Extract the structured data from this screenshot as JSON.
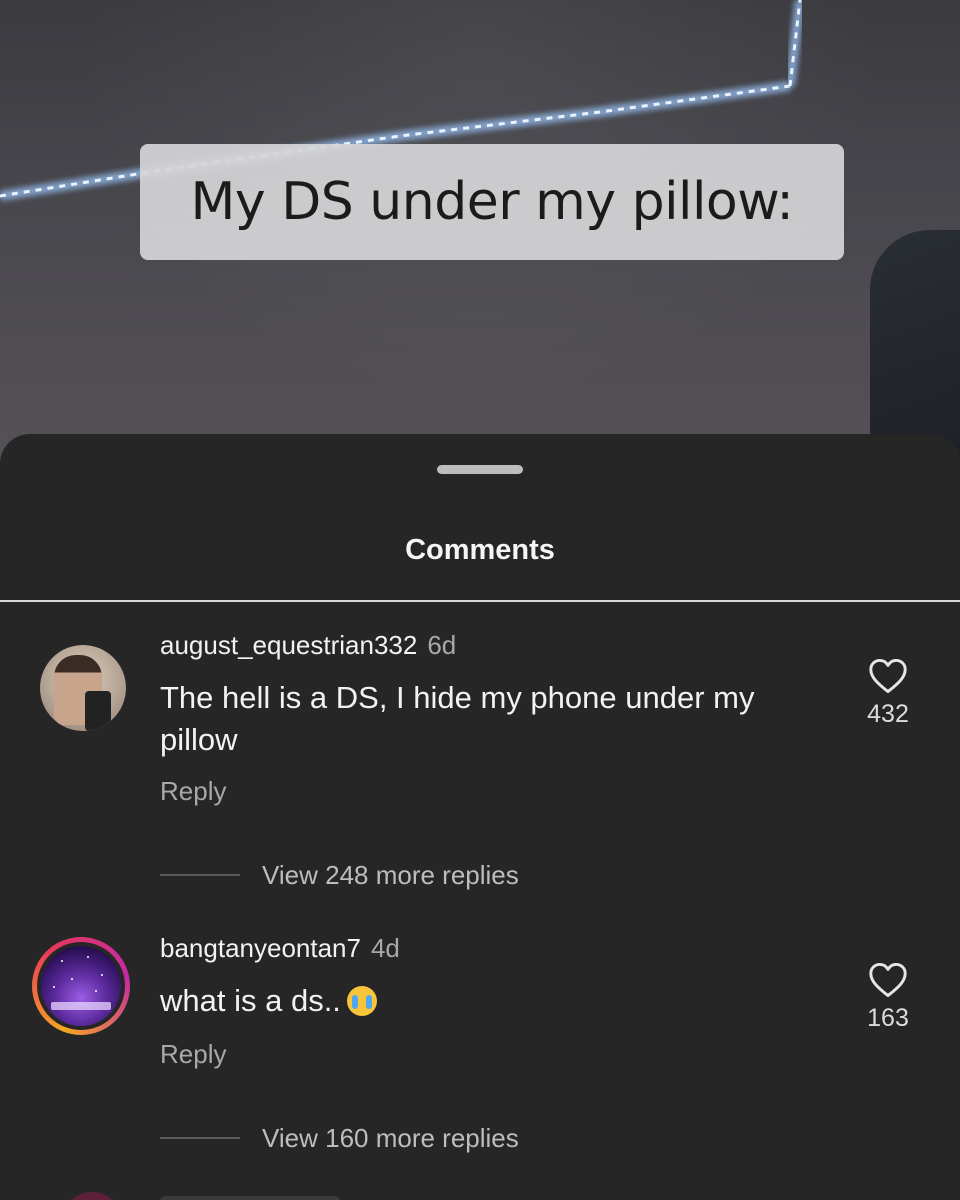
{
  "video": {
    "caption": "My DS under my pillow:"
  },
  "sheet": {
    "title": "Comments"
  },
  "comments": [
    {
      "username": "august_equestrian332",
      "time": "6d",
      "text": "The hell is a DS, I hide my phone under my pillow",
      "reply_label": "Reply",
      "likes": "432",
      "view_replies": "View 248 more replies"
    },
    {
      "username": "bangtanyeontan7",
      "time": "4d",
      "text": "what is a ds..",
      "emoji": "loudly-crying-face",
      "reply_label": "Reply",
      "likes": "163",
      "view_replies": "View 160 more replies"
    }
  ],
  "colors": {
    "sheet_bg": "#262626",
    "text_primary": "#f2f2f2",
    "text_secondary": "#a8a8a8"
  },
  "icons": {
    "like": "heart-outline-icon",
    "handle": "drag-handle"
  }
}
